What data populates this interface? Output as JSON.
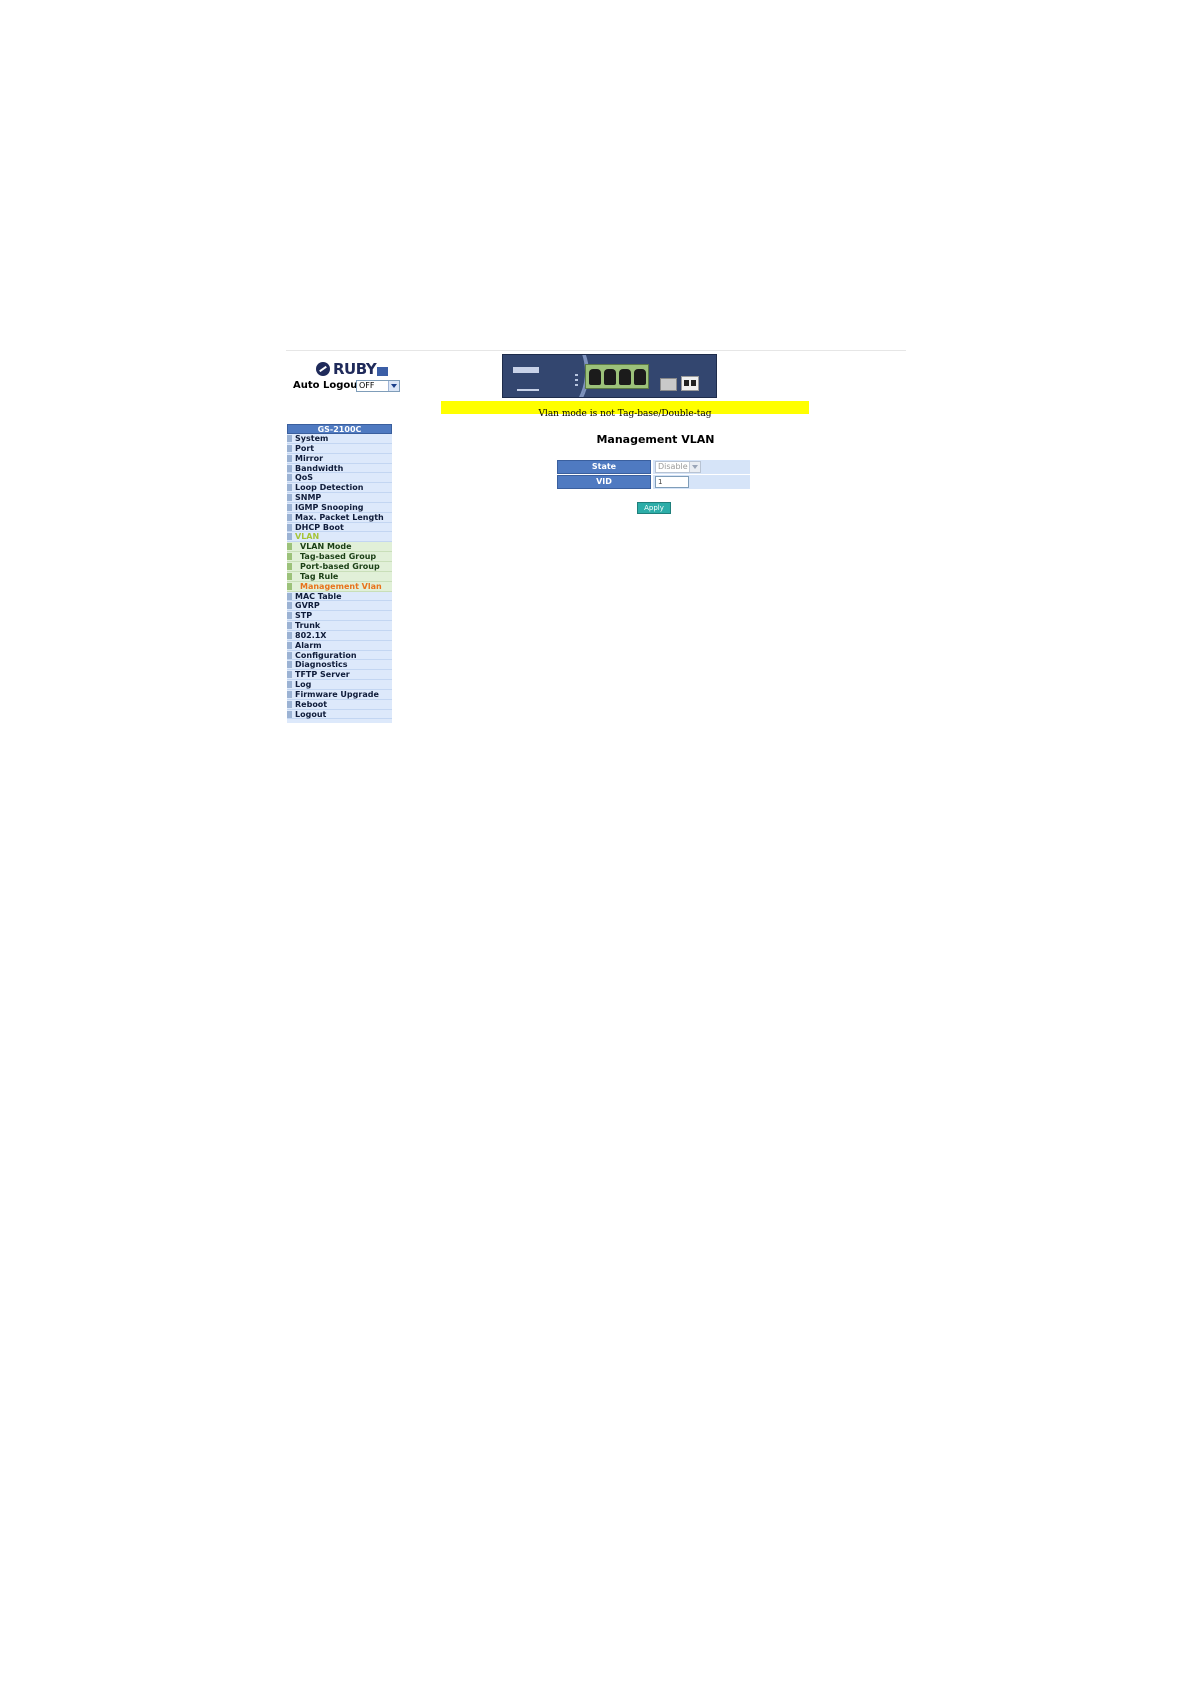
{
  "header": {
    "logo_text": "RUBY",
    "auto_logout_label": "Auto Logout",
    "auto_logout_value": "OFF",
    "device_image": "switch-front-panel-image",
    "warning": "Vlan mode is not Tag-base/Double-tag"
  },
  "sidebar": {
    "title": "GS-2100C",
    "items": [
      {
        "label": "System"
      },
      {
        "label": "Port"
      },
      {
        "label": "Mirror"
      },
      {
        "label": "Bandwidth"
      },
      {
        "label": "QoS"
      },
      {
        "label": "Loop Detection"
      },
      {
        "label": "SNMP"
      },
      {
        "label": "IGMP Snooping"
      },
      {
        "label": "Max. Packet Length"
      },
      {
        "label": "DHCP Boot"
      },
      {
        "label": "VLAN"
      },
      {
        "label": "VLAN Mode"
      },
      {
        "label": "Tag-based Group"
      },
      {
        "label": "Port-based Group"
      },
      {
        "label": "Tag Rule"
      },
      {
        "label": "Management Vlan"
      },
      {
        "label": "MAC Table"
      },
      {
        "label": "GVRP"
      },
      {
        "label": "STP"
      },
      {
        "label": "Trunk"
      },
      {
        "label": "802.1X"
      },
      {
        "label": "Alarm"
      },
      {
        "label": "Configuration"
      },
      {
        "label": "Diagnostics"
      },
      {
        "label": "TFTP Server"
      },
      {
        "label": "Log"
      },
      {
        "label": "Firmware Upgrade"
      },
      {
        "label": "Reboot"
      },
      {
        "label": "Logout"
      }
    ]
  },
  "main": {
    "title": "Management VLAN",
    "state_label": "State",
    "state_value": "Disable",
    "vid_label": "VID",
    "vid_value": "1",
    "apply_label": "Apply"
  },
  "colors": {
    "sidebar_header": "#4f7ac1",
    "menu_bg": "#dde9fb",
    "submenu_bg": "#e1f0d8",
    "active_item": "#e8731b",
    "warning_bg": "#ffff00",
    "apply_button": "#2cada8"
  }
}
